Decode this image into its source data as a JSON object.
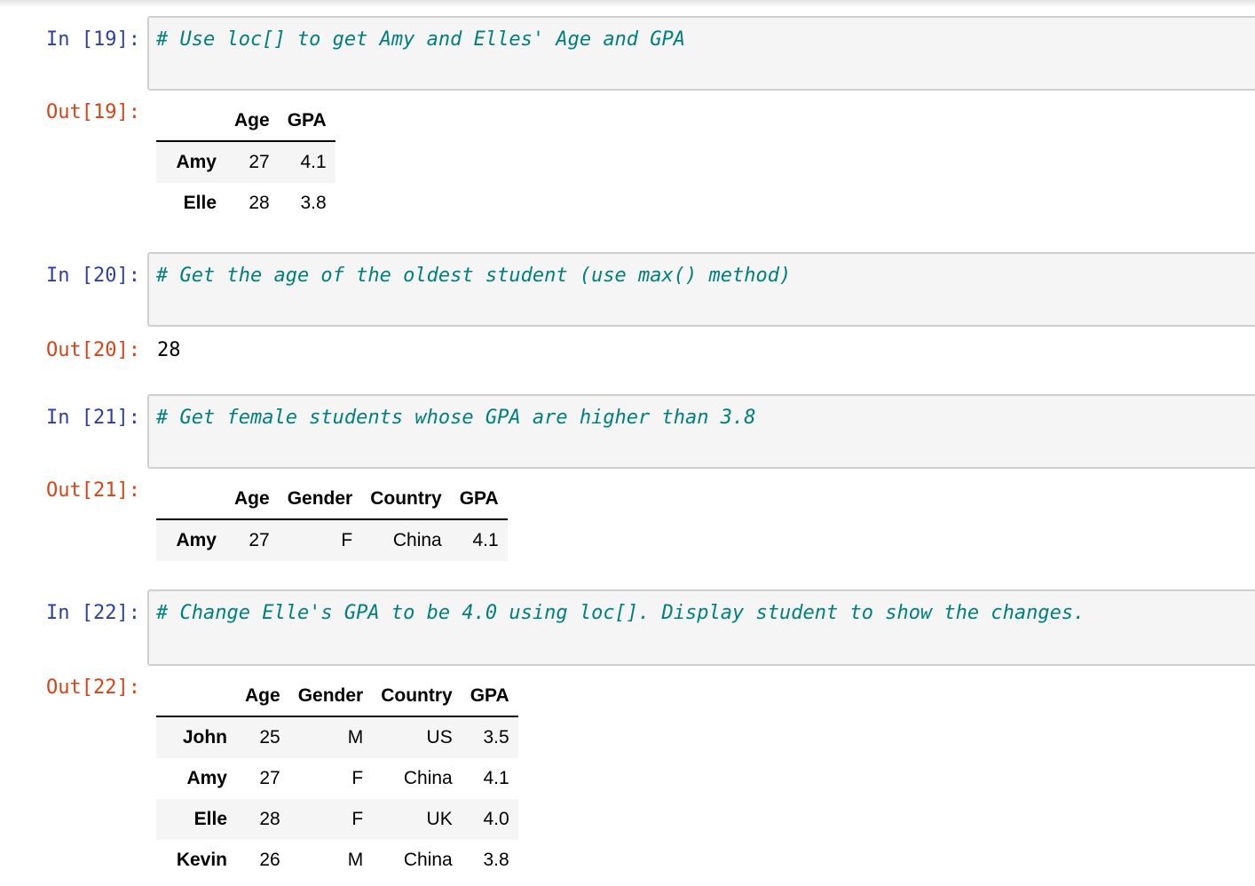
{
  "cells": [
    {
      "in_prompt": "In [19]:",
      "code": "# Use loc[] to get Amy and Elles' Age and GPA",
      "out_prompt": "Out[19]:",
      "table": {
        "columns": [
          "Age",
          "GPA"
        ],
        "rows": [
          {
            "index": "Amy",
            "values": [
              "27",
              "4.1"
            ]
          },
          {
            "index": "Elle",
            "values": [
              "28",
              "3.8"
            ]
          }
        ]
      }
    },
    {
      "in_prompt": "In [20]:",
      "code": "# Get the age of the oldest student (use max() method)",
      "out_prompt": "Out[20]:",
      "output_text": "28"
    },
    {
      "in_prompt": "In [21]:",
      "code": "# Get female students whose GPA are higher than 3.8",
      "out_prompt": "Out[21]:",
      "table": {
        "columns": [
          "Age",
          "Gender",
          "Country",
          "GPA"
        ],
        "rows": [
          {
            "index": "Amy",
            "values": [
              "27",
              "F",
              "China",
              "4.1"
            ]
          }
        ]
      }
    },
    {
      "in_prompt": "In [22]:",
      "code": "# Change Elle's GPA to be 4.0 using loc[]. Display student to show the changes.",
      "out_prompt": "Out[22]:",
      "table": {
        "columns": [
          "Age",
          "Gender",
          "Country",
          "GPA"
        ],
        "rows": [
          {
            "index": "John",
            "values": [
              "25",
              "M",
              "US",
              "3.5"
            ]
          },
          {
            "index": "Amy",
            "values": [
              "27",
              "F",
              "China",
              "4.1"
            ]
          },
          {
            "index": "Elle",
            "values": [
              "28",
              "F",
              "UK",
              "4.0"
            ]
          },
          {
            "index": "Kevin",
            "values": [
              "26",
              "M",
              "China",
              "3.8"
            ]
          }
        ]
      }
    }
  ]
}
